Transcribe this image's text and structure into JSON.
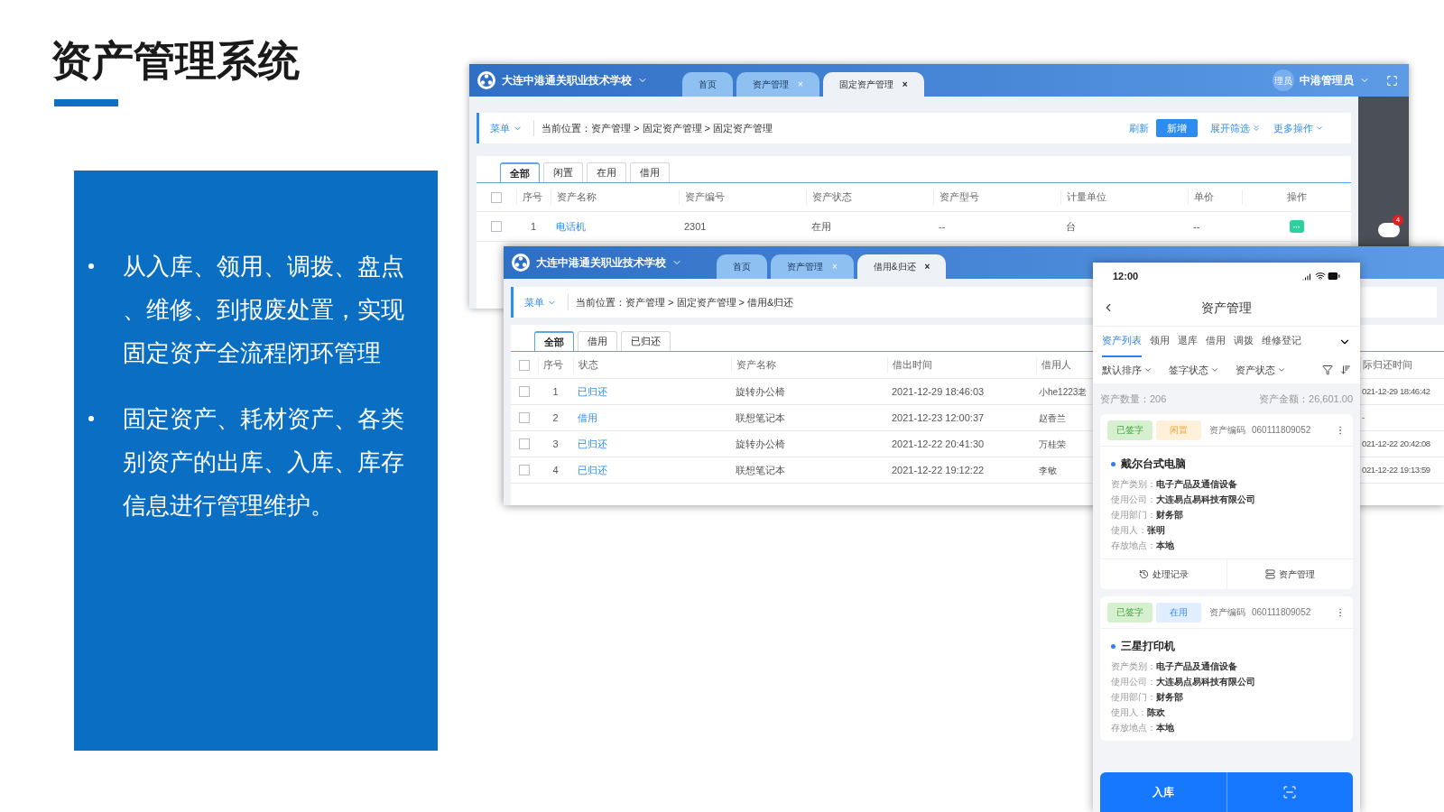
{
  "slide": {
    "title": "资产管理系统",
    "bullets": [
      "从入库、领用、调拨、盘点、维修、到报废处置，实现固定资产全流程闭环管理",
      "固定资产、耗材资产、各类别资产的出库、入库、库存信息进行管理维护。"
    ]
  },
  "back_window": {
    "school": "大连中港通关职业技术学校",
    "tabs": [
      {
        "label": "首页",
        "selected": false
      },
      {
        "label": "资产管理",
        "close": "×",
        "selected": false
      },
      {
        "label": "固定资产管理",
        "close": "×",
        "selected": true
      }
    ],
    "user": {
      "avatar": "理员",
      "name": "中港管理员"
    },
    "menu": "菜单",
    "breadcrumb": "当前位置：资产管理 > 固定资产管理 > 固定资产管理",
    "actions": {
      "refresh": "刷新",
      "add": "新增",
      "expand": "展开筛选",
      "more": "更多操作"
    },
    "filter_tabs": [
      {
        "label": "全部",
        "selected": true
      },
      {
        "label": "闲置",
        "selected": false
      },
      {
        "label": "在用",
        "selected": false
      },
      {
        "label": "借用",
        "selected": false
      }
    ],
    "table": {
      "select_all_checked": false,
      "columns": [
        "序号",
        "资产名称",
        "资产编号",
        "资产状态",
        "资产型号",
        "计量单位",
        "单价",
        "操作"
      ],
      "rows": [
        {
          "checked": false,
          "cells": [
            "1",
            "电话机",
            "2301",
            "在用",
            "--",
            "台",
            "--"
          ]
        }
      ]
    },
    "badge": "4"
  },
  "front_window": {
    "school": "大连中港通关职业技术学校",
    "tabs": [
      {
        "label": "首页",
        "selected": false
      },
      {
        "label": "资产管理",
        "close": "×",
        "selected": false
      },
      {
        "label": "借用&归还",
        "close": "×",
        "selected": true
      }
    ],
    "menu": "菜单",
    "breadcrumb": "当前位置：资产管理 > 固定资产管理 > 借用&归还",
    "filter_tabs": [
      {
        "label": "全部",
        "selected": true
      },
      {
        "label": "借用",
        "selected": false
      },
      {
        "label": "已归还",
        "selected": false
      }
    ],
    "table": {
      "select_all_checked": false,
      "columns": [
        "序号",
        "状态",
        "资产名称",
        "借出时间",
        "借用人",
        "际归还时间"
      ],
      "rows": [
        {
          "checked": false,
          "cells": [
            "1",
            "已归还",
            "旋转办公椅",
            "2021-12-29 18:46:03",
            "小he1223老",
            "021-12-29 18:46:42"
          ]
        },
        {
          "checked": false,
          "cells": [
            "2",
            "借用",
            "联想笔记本",
            "2021-12-23 12:00:37",
            "赵香兰",
            "-"
          ]
        },
        {
          "checked": false,
          "cells": [
            "3",
            "已归还",
            "旋转办公椅",
            "2021-12-22 20:41:30",
            "万桂荣",
            "021-12-22 20:42:08"
          ]
        },
        {
          "checked": false,
          "cells": [
            "4",
            "已归还",
            "联想笔记本",
            "2021-12-22 19:12:22",
            "李敏",
            "021-12-22 19:13:59"
          ]
        }
      ]
    }
  },
  "phone": {
    "time": "12:00",
    "title": "资产管理",
    "tabs": [
      {
        "label": "资产列表",
        "selected": true
      },
      {
        "label": "领用",
        "selected": false
      },
      {
        "label": "退库",
        "selected": false
      },
      {
        "label": "借用",
        "selected": false
      },
      {
        "label": "调拨",
        "selected": false
      },
      {
        "label": "维修登记",
        "selected": false
      }
    ],
    "filters": [
      "默认排序",
      "签字状态",
      "资产状态"
    ],
    "count": "资产数量：206",
    "amount": "资产金额：26,601.00",
    "cards": [
      {
        "tags": [
          {
            "label": "已签字",
            "kind": "signed",
            "color": "#d6f0cf"
          },
          {
            "label": "闲置",
            "kind": "idle",
            "color": "#fff1d9"
          }
        ],
        "code_label": "资产编码",
        "code": "060111809052",
        "name": "戴尔台式电脑",
        "fields": [
          {
            "label": "资产类别：",
            "value": "电子产品及通信设备"
          },
          {
            "label": "使用公司：",
            "value": "大连易点易科技有限公司"
          },
          {
            "label": "使用部门：",
            "value": "财务部"
          },
          {
            "label": "使用人：",
            "value": "张明"
          },
          {
            "label": "存放地点：",
            "value": "本地"
          }
        ],
        "actions": [
          "处理记录",
          "资产管理"
        ]
      },
      {
        "tags": [
          {
            "label": "已签字",
            "kind": "signed",
            "color": "#d6f0cf"
          },
          {
            "label": "在用",
            "kind": "in_use",
            "color": "#e1eeff"
          }
        ],
        "code_label": "资产编码",
        "code": "060111809052",
        "name": "三星打印机",
        "fields": [
          {
            "label": "资产类别：",
            "value": "电子产品及通信设备"
          },
          {
            "label": "使用公司：",
            "value": "大连易点易科技有限公司"
          },
          {
            "label": "使用部门：",
            "value": "财务部"
          },
          {
            "label": "使用人：",
            "value": "陈欢"
          },
          {
            "label": "存放地点：",
            "value": "本地"
          }
        ]
      }
    ],
    "bottom_button": "入库"
  }
}
